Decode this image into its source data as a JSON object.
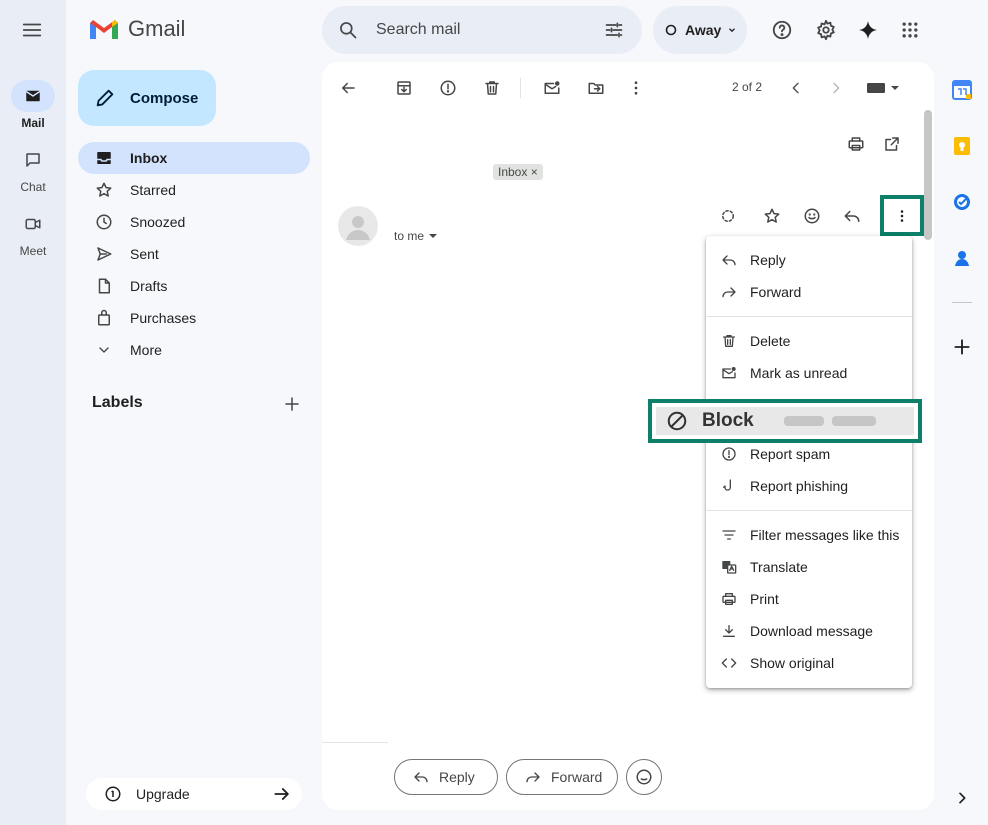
{
  "rail": {
    "items": [
      {
        "label": "Mail",
        "icon": "mail-icon",
        "active": true
      },
      {
        "label": "Chat",
        "icon": "chat-icon",
        "active": false
      },
      {
        "label": "Meet",
        "icon": "meet-icon",
        "active": false
      }
    ]
  },
  "brand": {
    "name": "Gmail",
    "colors": {
      "red": "#ea4335",
      "blue": "#4285f4",
      "green": "#34a853",
      "yellow": "#fbbc04"
    }
  },
  "compose": {
    "label": "Compose"
  },
  "nav": {
    "items": [
      {
        "label": "Inbox",
        "icon": "inbox-icon",
        "active": true
      },
      {
        "label": "Starred",
        "icon": "star-icon"
      },
      {
        "label": "Snoozed",
        "icon": "clock-icon"
      },
      {
        "label": "Sent",
        "icon": "send-icon"
      },
      {
        "label": "Drafts",
        "icon": "draft-icon"
      },
      {
        "label": "Purchases",
        "icon": "shopping-bag-icon"
      },
      {
        "label": "More",
        "icon": "chevron-down-icon"
      }
    ]
  },
  "labels": {
    "title": "Labels"
  },
  "upgrade": {
    "label": "Upgrade"
  },
  "search": {
    "placeholder": "Search mail"
  },
  "status": {
    "label": "Away"
  },
  "toolbar": {
    "pagination": "2 of 2"
  },
  "message": {
    "chip": "Inbox",
    "chip_close": "×",
    "to": "to me"
  },
  "bottom": {
    "reply": "Reply",
    "forward": "Forward"
  },
  "menu": {
    "items": [
      {
        "label": "Reply",
        "icon": "reply-icon"
      },
      {
        "label": "Forward",
        "icon": "forward-icon"
      },
      {
        "label": "Delete",
        "icon": "trash-icon"
      },
      {
        "label": "Mark as unread",
        "icon": "mark-unread-icon"
      },
      {
        "label": "Block",
        "icon": "block-icon"
      },
      {
        "label": "Report spam",
        "icon": "report-spam-icon"
      },
      {
        "label": "Report phishing",
        "icon": "phishing-hook-icon"
      },
      {
        "label": "Filter messages like this",
        "icon": "filter-icon"
      },
      {
        "label": "Translate",
        "icon": "translate-icon"
      },
      {
        "label": "Print",
        "icon": "print-icon"
      },
      {
        "label": "Download message",
        "icon": "download-icon"
      },
      {
        "label": "Show original",
        "icon": "code-icon"
      }
    ]
  },
  "highlight_color": "#0e7f69"
}
